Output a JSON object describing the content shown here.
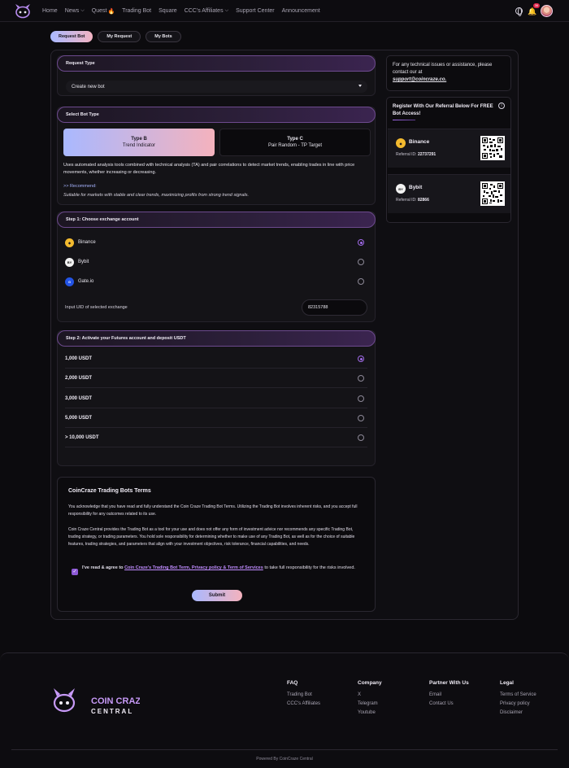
{
  "nav": {
    "items": [
      {
        "label": "Home",
        "dropdown": false
      },
      {
        "label": "News",
        "dropdown": true
      },
      {
        "label": "Quest",
        "dropdown": false,
        "badge_icon": "fire-icon"
      },
      {
        "label": "Trading Bot",
        "dropdown": false
      },
      {
        "label": "Square",
        "dropdown": false
      },
      {
        "label": "CCC's Affiliates",
        "dropdown": true
      },
      {
        "label": "Support Center",
        "dropdown": false
      },
      {
        "label": "Announcement",
        "dropdown": false
      }
    ],
    "notification_count": "36"
  },
  "tabs": [
    "Request Bot",
    "My Request",
    "My Bots"
  ],
  "request_type": {
    "header": "Request Type",
    "selected": "Create new bot"
  },
  "bot_type": {
    "header": "Select Bot Type",
    "options": [
      {
        "title": "Type B",
        "subtitle": "Trend Indicator",
        "selected": true
      },
      {
        "title": "Type C",
        "subtitle": "Pair Random - TP Target",
        "selected": false
      }
    ],
    "description": "Uses automated analysis tools combined with technical analysis (TA) and pair correlations to detect market trends, enabling trades in line with price movements, whether increasing or decreasing.",
    "recommend_label": ">> Recommend:",
    "recommend_text": "Suitable for markets with stable and clear trends, maximizing profits from strong trend signals."
  },
  "step1": {
    "header": "Step 1: Choose exchange account",
    "exchanges": [
      {
        "name": "Binance",
        "selected": true
      },
      {
        "name": "Bybit",
        "selected": false
      },
      {
        "name": "Gate.io",
        "selected": false
      }
    ],
    "uid_label": "Input UID of selected exchange",
    "uid_value": "82315788"
  },
  "step2": {
    "header": "Step 2: Activate your Futures account and deposit USDT",
    "amounts": [
      {
        "label": "1,000 USDT",
        "selected": true
      },
      {
        "label": "2,000 USDT",
        "selected": false
      },
      {
        "label": "3,000 USDT",
        "selected": false
      },
      {
        "label": "5,000 USDT",
        "selected": false
      },
      {
        "label": "> 10,000 USDT",
        "selected": false
      }
    ]
  },
  "terms": {
    "title": "CoinCraze Trading Bots Terms",
    "p1": "You acknowledge that you have read and fully understand the Coin Craze Trading Bot Terms. Utilizing the Trading Bot involves inherent risks, and you accept full responsibility for any outcomes related to its use.",
    "p2": "Coin Craze Central provides the Trading Bot as a tool for your use and does not offer any form of investment advice nor recommends any specific Trading Bot, trading strategy, or trading parameters. You hold sole responsibility for determining whether to make use of any Trading Bot, as well as for the choice of suitable features, trading strategies, and parameters that align with your investment objectives, risk tolerance, financial capabilities, and needs.",
    "agree_prefix": "I've read & agree to",
    "agree_link": "Coin Craze's Trading Bot Term, Privacy policy & Term of Services",
    "agree_suffix": "to take full responsibility for the risks involved.",
    "submit": "Submit"
  },
  "support": {
    "text": "For any technical issues or assistance, please contact our at",
    "email": "support@coincraze.co."
  },
  "referral": {
    "title": "Register With Our Referral Below For FREE Bot Access!",
    "cards": [
      {
        "name": "Binance",
        "id_label": "Referral ID:",
        "id": "22737291"
      },
      {
        "name": "Bybit",
        "id_label": "Referral ID:",
        "id": "82866"
      }
    ]
  },
  "footer": {
    "brand_line1": "COIN CRAZE",
    "brand_line2": "CENTRAL",
    "columns": [
      {
        "title": "FAQ",
        "links": [
          "Trading Bot",
          "CCC's Affiliates"
        ]
      },
      {
        "title": "Company",
        "links": [
          "X",
          "Telegram",
          "Youtube"
        ]
      },
      {
        "title": "Partner With Us",
        "links": [
          "Email",
          "Contact Us"
        ]
      },
      {
        "title": "Legal",
        "links": [
          "Terms of Service",
          "Privacy policy",
          "Disclaimer"
        ]
      }
    ],
    "powered": "Powered By CoinCraze Central"
  },
  "colors": {
    "accent_gradient_start": "#a9b8ff",
    "accent_gradient_end": "#f4b2bd",
    "purple": "#a06ae8",
    "background": "#0c0b0e"
  }
}
